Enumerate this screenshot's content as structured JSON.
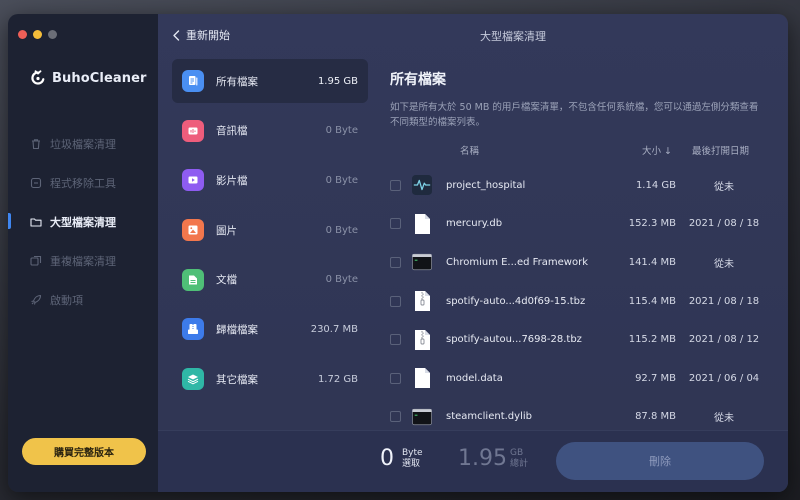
{
  "app": {
    "name": "BuhoCleaner",
    "window_title": "大型檔案清理"
  },
  "sidebar": {
    "items": [
      {
        "label": "垃圾檔案清理",
        "icon": "trash-icon",
        "active": false
      },
      {
        "label": "程式移除工具",
        "icon": "app-uninstall-icon",
        "active": false
      },
      {
        "label": "大型檔案清理",
        "icon": "folder-icon",
        "active": true
      },
      {
        "label": "重複檔案清理",
        "icon": "duplicate-icon",
        "active": false
      },
      {
        "label": "啟動項",
        "icon": "rocket-icon",
        "active": false
      }
    ],
    "buy_label": "購買完整版本"
  },
  "topbar": {
    "back_label": "重新開始"
  },
  "categories": [
    {
      "name": "所有檔案",
      "size": "1.95 GB",
      "icon": "all-files-icon",
      "color": "#4a8ff2",
      "active": true
    },
    {
      "name": "音訊檔",
      "size": "0 Byte",
      "icon": "audio-icon",
      "color": "#ee5d7c",
      "active": false
    },
    {
      "name": "影片檔",
      "size": "0 Byte",
      "icon": "video-icon",
      "color": "#8e5cf1",
      "active": false
    },
    {
      "name": "圖片",
      "size": "0 Byte",
      "icon": "image-icon",
      "color": "#f2774d",
      "active": false
    },
    {
      "name": "文檔",
      "size": "0 Byte",
      "icon": "document-icon",
      "color": "#4fbf77",
      "active": false
    },
    {
      "name": "歸檔檔案",
      "size": "230.7 MB",
      "icon": "archive-icon",
      "color": "#3d7bea",
      "active": false
    },
    {
      "name": "其它檔案",
      "size": "1.72 GB",
      "icon": "layers-icon",
      "color": "#2fb7a6",
      "active": false
    }
  ],
  "file_list": {
    "title": "所有檔案",
    "description": "如下是所有大於 50 MB 的用戶檔案清單，不包含任何系統檔，您可以通過左側分類查看不同類型的檔案列表。",
    "columns": {
      "name": "名稱",
      "size": "大小 ↓",
      "date": "最後打開日期"
    },
    "files": [
      {
        "name": "project_hospital",
        "size": "1.14 GB",
        "date": "從未",
        "icon": "waveform-app-icon"
      },
      {
        "name": "mercury.db",
        "size": "152.3 MB",
        "date": "2021 / 08 / 18",
        "icon": "blank-document-icon"
      },
      {
        "name": "Chromium E...ed Framework",
        "size": "141.4 MB",
        "date": "從未",
        "icon": "terminal-exec-icon"
      },
      {
        "name": "spotify-auto...4d0f69-15.tbz",
        "size": "115.4 MB",
        "date": "2021 / 08 / 18",
        "icon": "zip-archive-icon"
      },
      {
        "name": "spotify-autou...7698-28.tbz",
        "size": "115.2 MB",
        "date": "2021 / 08 / 12",
        "icon": "zip-archive-icon"
      },
      {
        "name": "model.data",
        "size": "92.7 MB",
        "date": "2021 / 06 / 04",
        "icon": "blank-document-icon"
      },
      {
        "name": "steamclient.dylib",
        "size": "87.8 MB",
        "date": "從未",
        "icon": "terminal-exec-icon"
      }
    ]
  },
  "footer": {
    "selected_value": "0",
    "selected_unit": "Byte",
    "selected_label": "選取",
    "total_value": "1.95",
    "total_unit": "GB",
    "total_label": "總計",
    "delete_label": "刪除"
  }
}
